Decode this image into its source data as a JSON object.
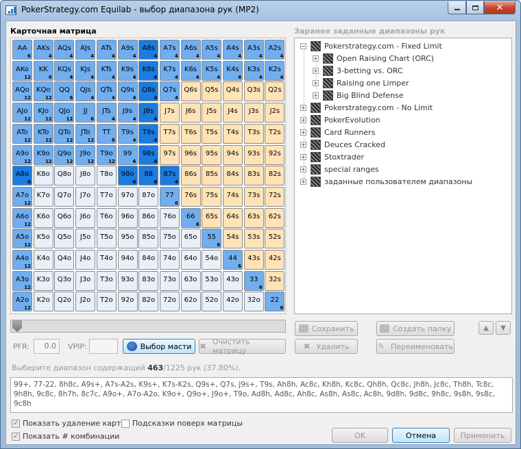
{
  "window": {
    "title": "PokerStrategy.com Equilab - выбор диапазона рук (MP2)"
  },
  "matrix": {
    "label": "Карточная матрица",
    "rows": [
      [
        [
          "AA",
          "6",
          "sel"
        ],
        [
          "AKs",
          "4",
          "sel"
        ],
        [
          "AQs",
          "4",
          "sel"
        ],
        [
          "AJs",
          "4",
          "sel"
        ],
        [
          "ATs",
          "4",
          "sel"
        ],
        [
          "A9s",
          "4",
          "sel"
        ],
        [
          "A8s",
          "4",
          "sel2"
        ],
        [
          "A7s",
          "4",
          "sel"
        ],
        [
          "A6s",
          "4",
          "sel"
        ],
        [
          "A5s",
          "4",
          "sel"
        ],
        [
          "A4s",
          "4",
          "sel"
        ],
        [
          "A3s",
          "4",
          "sel"
        ],
        [
          "A2s",
          "4",
          "sel"
        ]
      ],
      [
        [
          "AKo",
          "12",
          "sel"
        ],
        [
          "KK",
          "6",
          "sel"
        ],
        [
          "KQs",
          "4",
          "sel"
        ],
        [
          "KJs",
          "4",
          "sel"
        ],
        [
          "KTs",
          "4",
          "sel"
        ],
        [
          "K9s",
          "4",
          "sel"
        ],
        [
          "K8s",
          "4",
          "sel2"
        ],
        [
          "K7s",
          "4",
          "sel"
        ],
        [
          "K6s",
          "4",
          "sel"
        ],
        [
          "K5s",
          "4",
          "sel"
        ],
        [
          "K4s",
          "4",
          "sel"
        ],
        [
          "K3s",
          "4",
          "sel"
        ],
        [
          "K2s",
          "4",
          "sel"
        ]
      ],
      [
        [
          "AQo",
          "12",
          "sel"
        ],
        [
          "KQo",
          "12",
          "sel"
        ],
        [
          "QQ",
          "6",
          "sel"
        ],
        [
          "QJs",
          "4",
          "sel"
        ],
        [
          "QTs",
          "4",
          "sel"
        ],
        [
          "Q9s",
          "4",
          "sel"
        ],
        [
          "Q8s",
          "4",
          "sel2"
        ],
        [
          "Q7s",
          "4",
          "sel"
        ],
        [
          "Q6s",
          "",
          "s"
        ],
        [
          "Q5s",
          "",
          "s"
        ],
        [
          "Q4s",
          "",
          "s"
        ],
        [
          "Q3s",
          "",
          "s"
        ],
        [
          "Q2s",
          "",
          "s"
        ]
      ],
      [
        [
          "AJo",
          "12",
          "sel"
        ],
        [
          "KJo",
          "12",
          "sel"
        ],
        [
          "QJo",
          "12",
          "sel"
        ],
        [
          "JJ",
          "6",
          "sel"
        ],
        [
          "JTs",
          "4",
          "sel"
        ],
        [
          "J9s",
          "4",
          "sel"
        ],
        [
          "J8s",
          "4",
          "sel2"
        ],
        [
          "J7s",
          "",
          "s"
        ],
        [
          "J6s",
          "",
          "s"
        ],
        [
          "J5s",
          "",
          "s"
        ],
        [
          "J4s",
          "",
          "s"
        ],
        [
          "J3s",
          "",
          "s"
        ],
        [
          "J2s",
          "",
          "s"
        ]
      ],
      [
        [
          "ATo",
          "12",
          "sel"
        ],
        [
          "KTo",
          "12",
          "sel"
        ],
        [
          "QTo",
          "12",
          "sel"
        ],
        [
          "JTo",
          "12",
          "sel"
        ],
        [
          "TT",
          "6",
          "sel"
        ],
        [
          "T9s",
          "4",
          "sel"
        ],
        [
          "T8s",
          "4",
          "sel2"
        ],
        [
          "T7s",
          "",
          "s"
        ],
        [
          "T6s",
          "",
          "s"
        ],
        [
          "T5s",
          "",
          "s"
        ],
        [
          "T4s",
          "",
          "s"
        ],
        [
          "T3s",
          "",
          "s"
        ],
        [
          "T2s",
          "",
          "s"
        ]
      ],
      [
        [
          "A9o",
          "12",
          "sel"
        ],
        [
          "K9o",
          "12",
          "sel"
        ],
        [
          "Q9o",
          "12",
          "sel"
        ],
        [
          "J9o",
          "12",
          "sel"
        ],
        [
          "T9o",
          "12",
          "sel"
        ],
        [
          "99",
          "6",
          "sel"
        ],
        [
          "98s",
          "4",
          "sel2"
        ],
        [
          "97s",
          "",
          "s"
        ],
        [
          "96s",
          "",
          "s"
        ],
        [
          "95s",
          "",
          "s"
        ],
        [
          "94s",
          "",
          "s"
        ],
        [
          "93s",
          "",
          "s"
        ],
        [
          "92s",
          "",
          "s"
        ]
      ],
      [
        [
          "A8o",
          "6",
          "sel2"
        ],
        [
          "K8o",
          "",
          "o"
        ],
        [
          "Q8o",
          "",
          "o"
        ],
        [
          "J8o",
          "",
          "o"
        ],
        [
          "T8o",
          "",
          "o"
        ],
        [
          "98o",
          "6",
          "sel2"
        ],
        [
          "88",
          "6",
          "sel2"
        ],
        [
          "87s",
          "4",
          "sel2"
        ],
        [
          "86s",
          "",
          "s"
        ],
        [
          "85s",
          "",
          "s"
        ],
        [
          "84s",
          "",
          "s"
        ],
        [
          "83s",
          "",
          "s"
        ],
        [
          "82s",
          "",
          "s"
        ]
      ],
      [
        [
          "A7o",
          "12",
          "sel"
        ],
        [
          "K7o",
          "",
          "o"
        ],
        [
          "Q7o",
          "",
          "o"
        ],
        [
          "J7o",
          "",
          "o"
        ],
        [
          "T7o",
          "",
          "o"
        ],
        [
          "97o",
          "",
          "o"
        ],
        [
          "87o",
          "",
          "o"
        ],
        [
          "77",
          "6",
          "sel"
        ],
        [
          "76s",
          "",
          "s"
        ],
        [
          "75s",
          "",
          "s"
        ],
        [
          "74s",
          "",
          "s"
        ],
        [
          "73s",
          "",
          "s"
        ],
        [
          "72s",
          "",
          "s"
        ]
      ],
      [
        [
          "A6o",
          "12",
          "sel"
        ],
        [
          "K6o",
          "",
          "o"
        ],
        [
          "Q6o",
          "",
          "o"
        ],
        [
          "J6o",
          "",
          "o"
        ],
        [
          "T6o",
          "",
          "o"
        ],
        [
          "96o",
          "",
          "o"
        ],
        [
          "86o",
          "",
          "o"
        ],
        [
          "76o",
          "",
          "o"
        ],
        [
          "66",
          "6",
          "sel"
        ],
        [
          "65s",
          "",
          "s"
        ],
        [
          "64s",
          "",
          "s"
        ],
        [
          "63s",
          "",
          "s"
        ],
        [
          "62s",
          "",
          "s"
        ]
      ],
      [
        [
          "A5o",
          "12",
          "sel"
        ],
        [
          "K5o",
          "",
          "o"
        ],
        [
          "Q5o",
          "",
          "o"
        ],
        [
          "J5o",
          "",
          "o"
        ],
        [
          "T5o",
          "",
          "o"
        ],
        [
          "95o",
          "",
          "o"
        ],
        [
          "85o",
          "",
          "o"
        ],
        [
          "75o",
          "",
          "o"
        ],
        [
          "65o",
          "",
          "o"
        ],
        [
          "55",
          "6",
          "sel"
        ],
        [
          "54s",
          "",
          "s"
        ],
        [
          "53s",
          "",
          "s"
        ],
        [
          "52s",
          "",
          "s"
        ]
      ],
      [
        [
          "A4o",
          "12",
          "sel"
        ],
        [
          "K4o",
          "",
          "o"
        ],
        [
          "Q4o",
          "",
          "o"
        ],
        [
          "J4o",
          "",
          "o"
        ],
        [
          "T4o",
          "",
          "o"
        ],
        [
          "94o",
          "",
          "o"
        ],
        [
          "84o",
          "",
          "o"
        ],
        [
          "74o",
          "",
          "o"
        ],
        [
          "64o",
          "",
          "o"
        ],
        [
          "54o",
          "",
          "o"
        ],
        [
          "44",
          "6",
          "sel"
        ],
        [
          "43s",
          "",
          "s"
        ],
        [
          "42s",
          "",
          "s"
        ]
      ],
      [
        [
          "A3o",
          "12",
          "sel"
        ],
        [
          "K3o",
          "",
          "o"
        ],
        [
          "Q3o",
          "",
          "o"
        ],
        [
          "J3o",
          "",
          "o"
        ],
        [
          "T3o",
          "",
          "o"
        ],
        [
          "93o",
          "",
          "o"
        ],
        [
          "83o",
          "",
          "o"
        ],
        [
          "73o",
          "",
          "o"
        ],
        [
          "63o",
          "",
          "o"
        ],
        [
          "53o",
          "",
          "o"
        ],
        [
          "43o",
          "",
          "o"
        ],
        [
          "33",
          "6",
          "sel"
        ],
        [
          "32s",
          "",
          "s"
        ]
      ],
      [
        [
          "A2o",
          "12",
          "sel"
        ],
        [
          "K2o",
          "",
          "o"
        ],
        [
          "Q2o",
          "",
          "o"
        ],
        [
          "J2o",
          "",
          "o"
        ],
        [
          "T2o",
          "",
          "o"
        ],
        [
          "92o",
          "",
          "o"
        ],
        [
          "82o",
          "",
          "o"
        ],
        [
          "72o",
          "",
          "o"
        ],
        [
          "62o",
          "",
          "o"
        ],
        [
          "52o",
          "",
          "o"
        ],
        [
          "42o",
          "",
          "o"
        ],
        [
          "32o",
          "",
          "o"
        ],
        [
          "22",
          "6",
          "sel"
        ]
      ]
    ]
  },
  "controls": {
    "pfr_label": "PFR:",
    "pfr_value": "0.0",
    "vpip_label": "VPIP:",
    "vpip_value": "",
    "suits_button": "Выбор масти",
    "clear_button": "Очистить матрицу",
    "select_prefix": "Выберите диапазон содержащий ",
    "select_count": "463",
    "select_suffix": "/1225 рук (37.80%).",
    "range_text": "99+, 77-22, 8h8c, A9s+, A7s-A2s, K9s+, K7s-K2s, Q9s+, Q7s, J9s+, T9s, Ah8h, Ac8c, Kh8h, Kc8c, Qh8h, Qc8c, Jh8h, Jc8c, Th8h, Tc8c, 9h8h, 9c8c, 8h7h, 8c7c, A9o+, A7o-A2o, K9o+, Q9o+, J9o+, T9o, Ad8h, Ad8c, Ah8c, As8h, As8c, Ac8h, 9d8h, 9d8c, 9h8c, 9s8h, 9s8c, 9c8h"
  },
  "checkboxes": {
    "show_removal": "Показать удаление карт",
    "show_combos": "Показать # комбинации",
    "hints": "Подсказки поверх матрицы"
  },
  "presets": {
    "label": "Заранее заданные диапазоны рук",
    "tree": [
      {
        "label": "Pokerstrategy.com - Fixed Limit",
        "level": 0,
        "sign": "−"
      },
      {
        "label": "Open Raising Chart (ORC)",
        "level": 1,
        "sign": "+"
      },
      {
        "label": "3-betting vs. ORC",
        "level": 1,
        "sign": "+"
      },
      {
        "label": "Raising one Limper",
        "level": 1,
        "sign": "+"
      },
      {
        "label": "Big Blind Defense",
        "level": 1,
        "sign": "+"
      },
      {
        "label": "Pokerstrategy.com - No Limit",
        "level": 0,
        "sign": "+"
      },
      {
        "label": "PokerEvolution",
        "level": 0,
        "sign": "+"
      },
      {
        "label": "Card Runners",
        "level": 0,
        "sign": "+"
      },
      {
        "label": "Deuces Cracked",
        "level": 0,
        "sign": "+"
      },
      {
        "label": "Stoxtrader",
        "level": 0,
        "sign": "+"
      },
      {
        "label": "special ranges",
        "level": 0,
        "sign": "+"
      },
      {
        "label": "заданные пользователем диапазоны",
        "level": 0,
        "sign": "+"
      }
    ],
    "save": "Сохранить",
    "create_folder": "Создать папку",
    "delete": "Удалить",
    "rename": "Переименовать"
  },
  "dialog": {
    "ok": "OK",
    "cancel": "Отмена",
    "apply": "Применить"
  },
  "colors": {
    "selected": "#71aeef",
    "selected_dark": "#1b7be0",
    "suited": "#ffe3b6",
    "offsuit": "#e9f0f9"
  }
}
